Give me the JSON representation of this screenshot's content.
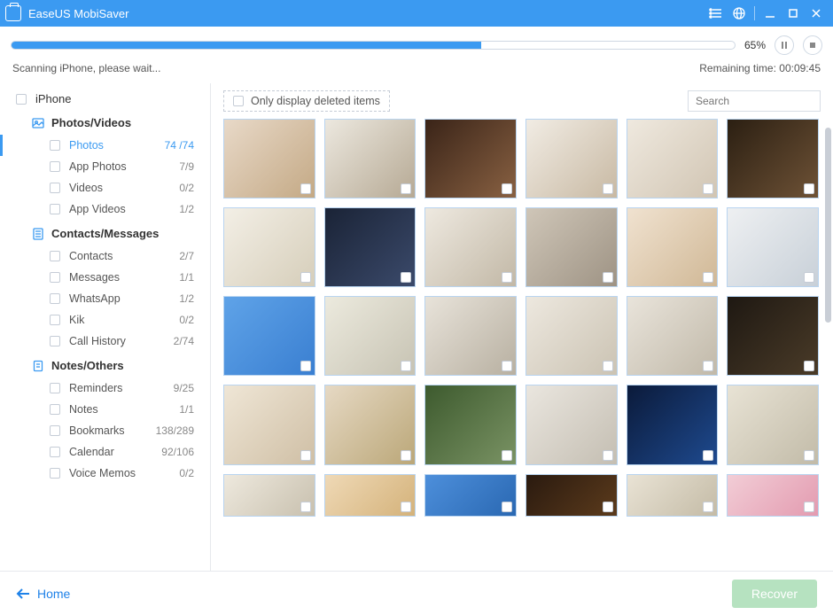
{
  "app": {
    "title": "EaseUS MobiSaver"
  },
  "progress": {
    "percent_label": "65%",
    "percent": 65
  },
  "status": {
    "left": "Scanning iPhone, please wait...",
    "right_label": "Remaining time:",
    "right_time": "00:09:45"
  },
  "sidebar": {
    "root": "iPhone",
    "sections": [
      {
        "title": "Photos/Videos",
        "items": [
          {
            "label": "Photos",
            "count": "74 /74",
            "active": true
          },
          {
            "label": "App Photos",
            "count": "7/9"
          },
          {
            "label": "Videos",
            "count": "0/2"
          },
          {
            "label": "App Videos",
            "count": "1/2"
          }
        ]
      },
      {
        "title": "Contacts/Messages",
        "items": [
          {
            "label": "Contacts",
            "count": "2/7"
          },
          {
            "label": "Messages",
            "count": "1/1"
          },
          {
            "label": "WhatsApp",
            "count": "1/2"
          },
          {
            "label": "Kik",
            "count": "0/2"
          },
          {
            "label": "Call History",
            "count": "2/74"
          }
        ]
      },
      {
        "title": "Notes/Others",
        "items": [
          {
            "label": "Reminders",
            "count": "9/25"
          },
          {
            "label": "Notes",
            "count": "1/1"
          },
          {
            "label": "Bookmarks",
            "count": "138/289"
          },
          {
            "label": "Calendar",
            "count": "92/106"
          },
          {
            "label": "Voice Memos",
            "count": "0/2"
          }
        ]
      }
    ]
  },
  "toolbar": {
    "filter_label": "Only display deleted items",
    "search_placeholder": "Search"
  },
  "footer": {
    "home": "Home",
    "recover": "Recover"
  },
  "grid": {
    "count": 30
  }
}
